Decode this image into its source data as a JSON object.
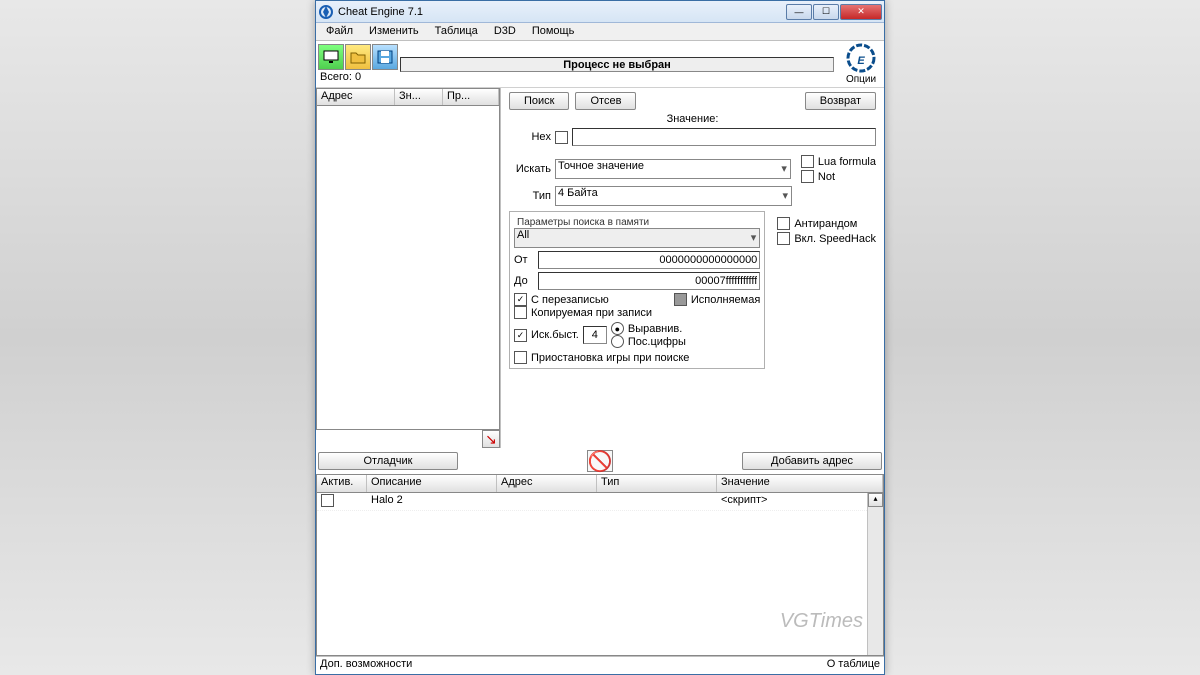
{
  "title": "Cheat Engine 7.1",
  "menu": [
    "Файл",
    "Изменить",
    "Таблица",
    "D3D",
    "Помощь"
  ],
  "process_bar": "Процесс не выбран",
  "options_label": "Опции",
  "results": {
    "total_label": "Всего:",
    "total_value": "0",
    "cols": {
      "address": "Адрес",
      "val": "Зн...",
      "prev": "Пр..."
    }
  },
  "search": {
    "scan_btn": "Поиск",
    "next_btn": "Отсев",
    "undo_btn": "Возврат",
    "value_label": "Значение:",
    "hex_label": "Hex",
    "scan_type_label": "Искать",
    "scan_type_value": "Точное значение",
    "value_type_label": "Тип",
    "value_type_value": "4 Байта",
    "lua_label": "Lua formula",
    "not_label": "Not",
    "mem_title": "Параметры поиска в памяти",
    "mem_all": "All",
    "from_label": "От",
    "from_value": "0000000000000000",
    "to_label": "До",
    "to_value": "00007fffffffffff",
    "antirandom": "Антирандом",
    "speedhack": "Вкл. SpeedHack",
    "writable": "С перезаписью",
    "executable": "Исполняемая",
    "cow": "Копируемая при записи",
    "fastscan": "Иск.быст.",
    "fastscan_value": "4",
    "align": "Выравнив.",
    "digits": "Пос.цифры",
    "pause": "Приостановка игры при поиске"
  },
  "mid": {
    "debugger": "Отладчик",
    "add_address": "Добавить адрес"
  },
  "table": {
    "cols": {
      "active": "Актив.",
      "desc": "Описание",
      "addr": "Адрес",
      "type": "Тип",
      "value": "Значение"
    },
    "rows": [
      {
        "active": false,
        "desc": "Halo 2",
        "addr": "",
        "type": "",
        "value": "<скрипт>"
      }
    ]
  },
  "status": {
    "left": "Доп. возможности",
    "right": "О таблице"
  },
  "watermark": "VGTimes"
}
